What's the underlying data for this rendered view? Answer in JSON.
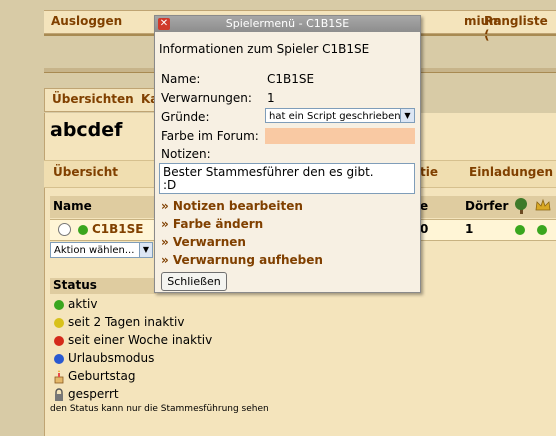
{
  "topnav": {
    "logout": "Ausloggen",
    "premium": "mium",
    "ranking": "Rangliste ("
  },
  "subnav": {
    "overview": "Übersichten",
    "ka": "Ka"
  },
  "page": {
    "title": "abcdef"
  },
  "tabs": {
    "overview": "Übersicht",
    "tie": "tie",
    "invites": "Einladungen"
  },
  "table": {
    "headers": {
      "name": "Name",
      "e": "e",
      "villages": "Dörfer"
    },
    "row": {
      "name": "C1B1SE",
      "points_suffix": "0",
      "villages": "1"
    }
  },
  "action_select": {
    "label": "Aktion wählen..."
  },
  "status": {
    "header": "Status",
    "items": [
      {
        "label": "aktiv",
        "color": "#3aa61e"
      },
      {
        "label": "seit 2 Tagen inaktiv",
        "color": "#d8c11a"
      },
      {
        "label": "seit einer Woche inaktiv",
        "color": "#d42a1a"
      },
      {
        "label": "Urlaubsmodus",
        "color": "#2a59d0"
      },
      {
        "label": "Geburtstag",
        "icon": "birthday-icon"
      },
      {
        "label": "gesperrt",
        "icon": "lock-icon"
      }
    ],
    "note": "den Status kann nur die Stammesführung sehen"
  },
  "popup": {
    "title": "Spielermenü - C1B1SE",
    "heading": "Informationen zum Spieler C1B1SE",
    "name_label": "Name:",
    "name_value": "C1B1SE",
    "warnings_label": "Verwarnungen:",
    "warnings_value": "1",
    "reasons_label": "Gründe:",
    "reasons_selected": "hat ein Script geschrieben",
    "color_label": "Farbe im Forum:",
    "notes_label": "Notizen:",
    "notes_line1": "Bester Stammesführer den es gibt.",
    "notes_line2": ":D",
    "links": {
      "edit_notes": "» Notizen bearbeiten",
      "change_color": "» Farbe ändern",
      "warn": "» Verwarnen",
      "remove_warning": "» Verwarnung aufheben"
    },
    "close_button": "Schließen"
  }
}
